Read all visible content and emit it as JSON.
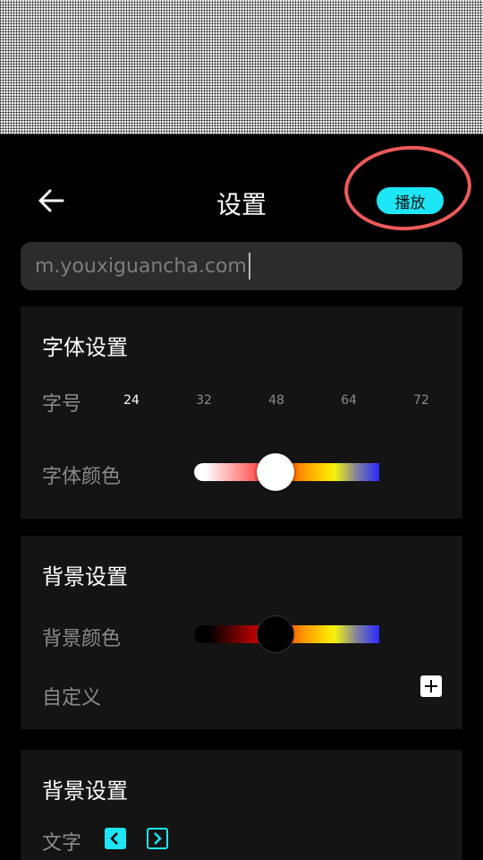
{
  "header": {
    "title": "设置",
    "play_label": "播放",
    "accent_color": "#1de6f6",
    "annotation_ring_color": "#ef5a5a"
  },
  "url_field": {
    "value": "m.youxiguancha.com"
  },
  "font_settings": {
    "title": "字体设置",
    "size_label": "字号",
    "sizes": [
      "24",
      "32",
      "48",
      "64",
      "72"
    ],
    "selected_size": "24",
    "color_label": "字体颜色",
    "color_slider_position": 0.44
  },
  "background_settings": {
    "title": "背景设置",
    "color_label": "背景颜色",
    "color_slider_position": 0.44,
    "custom_label": "自定义"
  },
  "background_settings_2": {
    "title": "背景设置",
    "text_label": "文字"
  },
  "icons": {
    "back": "arrow-left-icon",
    "add": "plus-icon",
    "prev": "chevron-left-icon",
    "next": "chevron-right-icon"
  }
}
